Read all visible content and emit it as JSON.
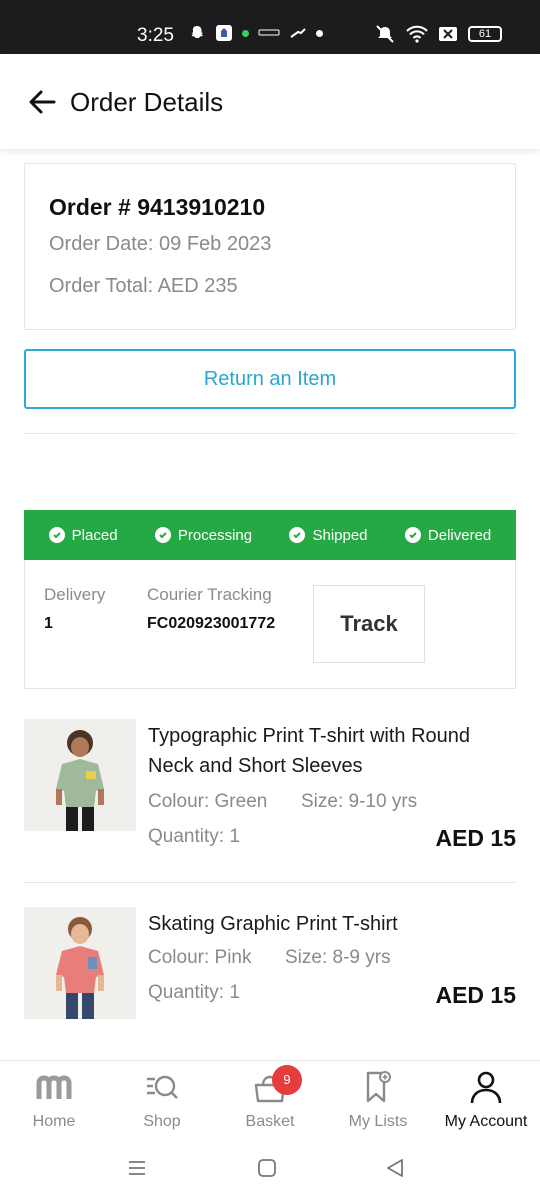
{
  "status_bar": {
    "time": "3:25",
    "battery": "61"
  },
  "header": {
    "title": "Order Details",
    "back_icon": "arrow-left-icon"
  },
  "order": {
    "number": "Order # 9413910210",
    "date": "Order Date: 09 Feb 2023",
    "total": "Order Total: AED 235"
  },
  "return_button": "Return an Item",
  "progress": {
    "color": "#25a944",
    "steps": [
      {
        "label": "Placed"
      },
      {
        "label": "Processing"
      },
      {
        "label": "Shipped"
      },
      {
        "label": "Delivered"
      }
    ]
  },
  "tracking": {
    "delivery_label": "Delivery",
    "delivery_value": "1",
    "courier_label": "Courier Tracking",
    "courier_value": "FC020923001772",
    "track_button": "Track"
  },
  "products": [
    {
      "name": "Typographic Print T-shirt with Round Neck and Short Sleeves",
      "colour": "Colour: Green",
      "size": "Size: 9-10 yrs",
      "quantity": "Quantity: 1",
      "price": "AED 15",
      "shirt_color": "#9fb99a"
    },
    {
      "name": "Skating Graphic Print T-shirt",
      "colour": "Colour: Pink",
      "size": "Size: 8-9 yrs",
      "quantity": "Quantity: 1",
      "price": "AED 15",
      "shirt_color": "#e77e7a"
    }
  ],
  "bottom_nav": {
    "items": [
      {
        "label": "Home",
        "icon": "home-m-logo-icon"
      },
      {
        "label": "Shop",
        "icon": "shop-search-icon"
      },
      {
        "label": "Basket",
        "icon": "basket-icon",
        "badge": "9"
      },
      {
        "label": "My Lists",
        "icon": "bookmark-icon"
      },
      {
        "label": "My Account",
        "icon": "user-icon",
        "active": true
      }
    ]
  },
  "accent_color": "#29a9d4"
}
